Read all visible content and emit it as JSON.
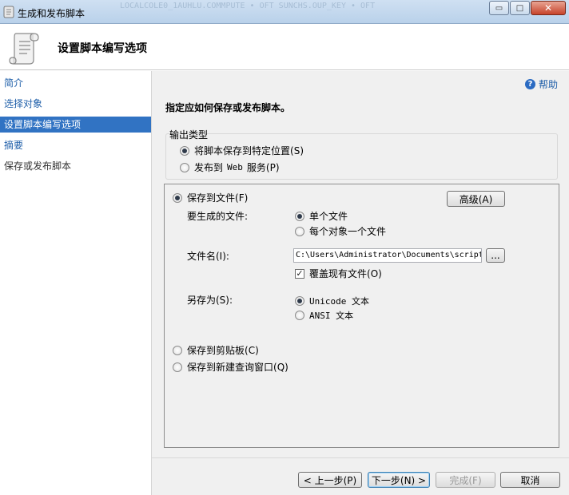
{
  "window": {
    "title": "生成和发布脚本",
    "background_title_text": "LOCALCOLE0_1AUHLU.COMMPUTE • OFT SUNCHS.OUP_KEY • OFT",
    "controls": {
      "minimize": "▭",
      "maximize": "□",
      "close": "✕"
    }
  },
  "header": {
    "title": "设置脚本编写选项"
  },
  "nav": {
    "items": [
      {
        "label": "简介"
      },
      {
        "label": "选择对象"
      },
      {
        "label": "设置脚本编写选项"
      },
      {
        "label": "摘要"
      },
      {
        "label": "保存或发布脚本"
      }
    ]
  },
  "help": {
    "label": "帮助",
    "icon_glyph": "?"
  },
  "instruction": "指定应如何保存或发布脚本。",
  "output_type": {
    "legend": "输出类型",
    "save_to_location": "将脚本保存到特定位置",
    "save_to_location_key": "(S)",
    "publish_prefix": "发布到",
    "publish_web": "Web",
    "publish_suffix": "服务",
    "publish_key": "(P)"
  },
  "save_options": {
    "save_to_file": "保存到文件",
    "save_to_file_key": "(F)",
    "advanced_button": "高级(A)",
    "files_label": "要生成的文件:",
    "single_file": "单个文件",
    "file_per_object": "每个对象一个文件",
    "filename_label": "文件名(I):",
    "filename_value": "C:\\Users\\Administrator\\Documents\\script",
    "browse_button": "...",
    "overwrite_label": "覆盖现有文件",
    "overwrite_key": "(O)",
    "overwrite_check": "✓",
    "save_as_label": "另存为(S):",
    "unicode_text": "Unicode 文本",
    "ansi_text": "ANSI 文本",
    "save_to_clipboard": "保存到剪贴板",
    "save_to_clipboard_key": "(C)",
    "save_to_query_window": "保存到新建查询窗口",
    "save_to_query_window_key": "(Q)"
  },
  "footer": {
    "prev_button": "< 上一步(P)",
    "next_button": "下一步(N) >",
    "finish_button": "完成(F)",
    "cancel_button": "取消"
  },
  "colors": {
    "nav_selected_bg": "#3173c3",
    "link_blue": "#1f5fa9",
    "content_bg": "#f0f0f0"
  }
}
